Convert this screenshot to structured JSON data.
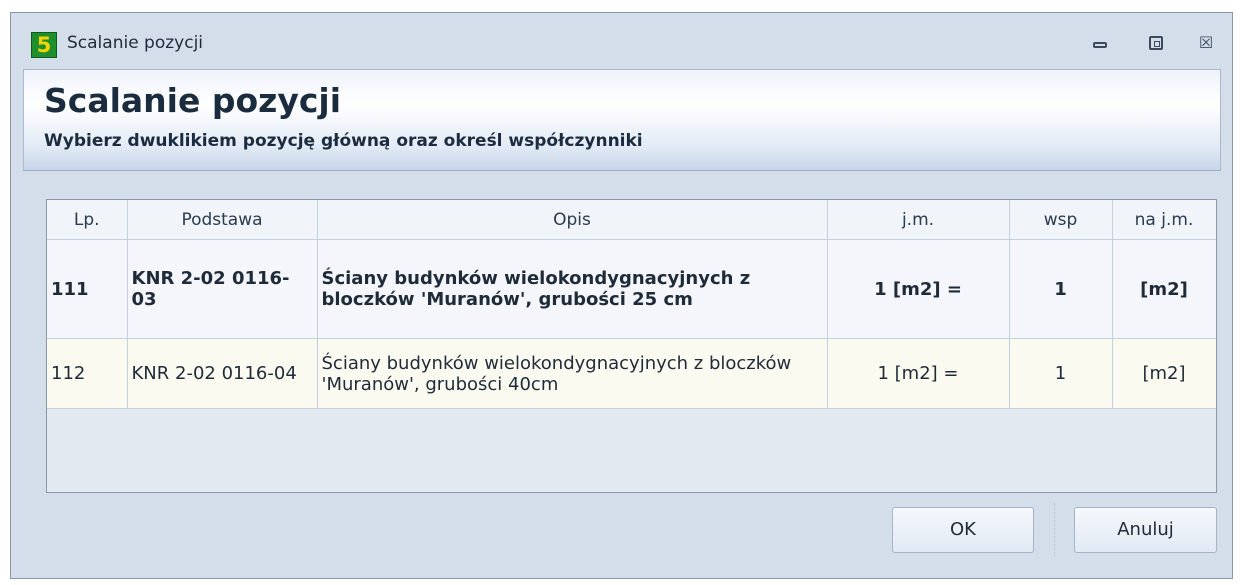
{
  "window": {
    "title": "Scalanie pozycji"
  },
  "app_icon": {
    "glyph": "5"
  },
  "header": {
    "title": "Scalanie pozycji",
    "subtitle": "Wybierz dwuklikiem pozycję główną oraz określ współczynniki"
  },
  "table": {
    "columns": [
      "Lp.",
      "Podstawa",
      "Opis",
      "j.m.",
      "wsp",
      "na j.m."
    ],
    "rows": [
      {
        "lp": "111",
        "podstawa": "KNR 2-02 0116-03",
        "opis": "Ściany budynków wielokondygnacyjnych z bloczków 'Muranów', grubości 25 cm",
        "jm": "1 [m2] =",
        "wsp": "1",
        "na_jm": "[m2]"
      },
      {
        "lp": "112",
        "podstawa": "KNR 2-02 0116-04",
        "opis": "Ściany budynków wielokondygnacyjnych z bloczków 'Muranów', grubości 40cm",
        "jm": "1 [m2] =",
        "wsp": "1",
        "na_jm": "[m2]"
      }
    ]
  },
  "buttons": {
    "ok": "OK",
    "cancel": "Anuluj"
  },
  "titlebar_buttons": {
    "close_glyph": "☒"
  }
}
